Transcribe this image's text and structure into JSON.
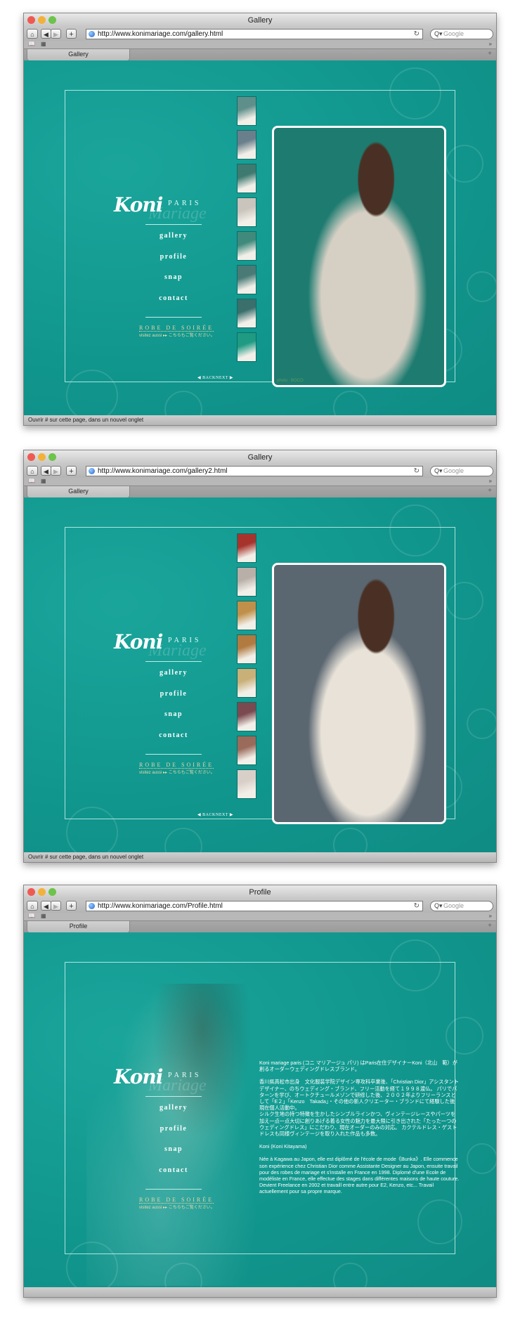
{
  "windows": [
    {
      "title": "Gallery",
      "url": "http://www.konimariage.com/gallery.html",
      "tab": "Gallery",
      "search_placeholder": "Google",
      "status": "Ouvrir # sur cette page, dans un nouvel onglet",
      "page": "gallery",
      "photo_caption": "photo : BOCO",
      "thumb_colors": [
        "#5f8f8a",
        "#6a7f8c",
        "#3f7a70",
        "#c9c4bc",
        "#3f8a7c",
        "#4a7a76",
        "#3a6f6c",
        "#1f9b84"
      ],
      "photo_bg": [
        "#1e7b70",
        "#d6cfc4"
      ]
    },
    {
      "title": "Gallery",
      "url": "http://www.konimariage.com/gallery2.html",
      "tab": "Gallery",
      "search_placeholder": "Google",
      "status": "Ouvrir # sur cette page, dans un nouvel onglet",
      "page": "gallery",
      "photo_caption": "",
      "thumb_colors": [
        "#a7342c",
        "#b8b0a8",
        "#c0904a",
        "#b07a40",
        "#c8b078",
        "#7a4a50",
        "#9a6a5a",
        "#d8d0c8"
      ],
      "photo_bg": [
        "#5a6670",
        "#e8e2d8"
      ]
    },
    {
      "title": "Profile",
      "url": "http://www.konimariage.com/Profile.html",
      "tab": "Profile",
      "search_placeholder": "Google",
      "status": "",
      "page": "profile"
    }
  ],
  "site": {
    "logo": "Koni",
    "logo_paris": "PARIS",
    "logo_mariage": "Mariage",
    "menu": [
      "gallery",
      "profile",
      "snap",
      "contact"
    ],
    "robe": "ROBE DE SOIRÉE",
    "visit": "visitez aussi ▸▸ こちらもご覧ください。",
    "back": "◀ BACK",
    "next": "NEXT ▶"
  },
  "profile": {
    "paragraphs": [
      "Koni mariage paris (コニ マリアージュ パリ) はParis在住デザイナーKoni（北山　範）が創るオーダーウェディングドレスブランド。",
      "香川県高松市出身　文化服装学院デザイン専攻科卒業後、「Christian Dior」アシスタントデザイナー、のちウェディング・ブランド、フリー活動を経て１９９８渡仏。 パリでパターンを学び、オートクチュールメゾンで研修した後、２００２年よりフリーランスとして「E２」「Kenzo　Takada」・その他の新人クリエーター・ブランドにて経験した後現在個人活動中。\nシルク生地の持つ特徴を生かしたシンプルラインかつ、ヴィンテージレースやパーツを加え一点一点大切に創りあげる着る女性の魅力を最大限に引き出された「たった一つのウェディングドレス」にこだわり、現在オーダーのみの対応。 カクテルドレス・ゲストドレスも同様ヴィンテージを取り入れた作品も多数。",
      "Koni (Koni Kitayama)",
      "Née à Kagawa au Japon, elle est diplômé de l'école de mode《Bunka》. Elle commence son expérience chez Christian Dior comme Assistante Designer au Japon, ensuite travail pour des robes de mariage et s'installe en France en 1998. Diplomé d'une Ecole de modéliste en France, elle effectue des stages dans différentes maisons de haute couture. Devient Freelance en 2002 et travaill entre autre pour E2, Kenzo, etc... Travail actuellement pour sa propre marque."
    ]
  },
  "colors": {
    "teal": "#12978e",
    "frame": "#cdf3ee"
  }
}
